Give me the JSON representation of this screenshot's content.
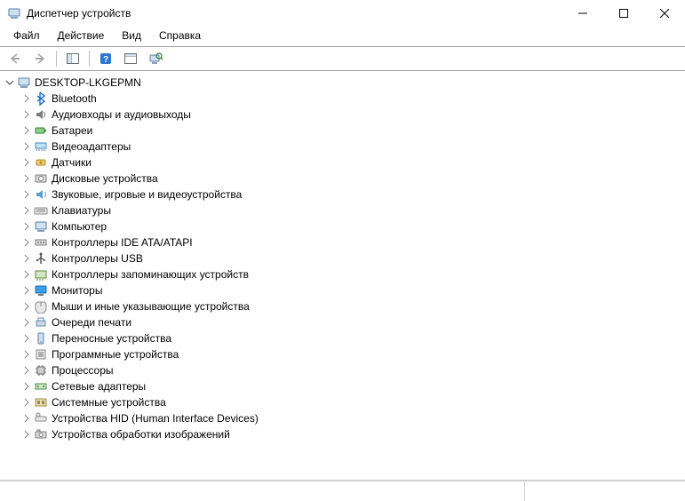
{
  "title": "Диспетчер устройств",
  "menu": {
    "file": "Файл",
    "action": "Действие",
    "view": "Вид",
    "help": "Справка"
  },
  "root": {
    "name": "DESKTOP-LKGEPMN"
  },
  "categories": [
    {
      "icon": "bluetooth",
      "label": "Bluetooth"
    },
    {
      "icon": "audio",
      "label": "Аудиовходы и аудиовыходы"
    },
    {
      "icon": "battery",
      "label": "Батареи"
    },
    {
      "icon": "display-adapter",
      "label": "Видеоадаптеры"
    },
    {
      "icon": "sensor",
      "label": "Датчики"
    },
    {
      "icon": "disk",
      "label": "Дисковые устройства"
    },
    {
      "icon": "sound-game",
      "label": "Звуковые, игровые и видеоустройства"
    },
    {
      "icon": "keyboard",
      "label": "Клавиатуры"
    },
    {
      "icon": "computer",
      "label": "Компьютер"
    },
    {
      "icon": "ide",
      "label": "Контроллеры IDE ATA/ATAPI"
    },
    {
      "icon": "usb",
      "label": "Контроллеры USB"
    },
    {
      "icon": "storage-ctrl",
      "label": "Контроллеры запоминающих устройств"
    },
    {
      "icon": "monitor",
      "label": "Мониторы"
    },
    {
      "icon": "mouse",
      "label": "Мыши и иные указывающие устройства"
    },
    {
      "icon": "print-queue",
      "label": "Очереди печати"
    },
    {
      "icon": "portable",
      "label": "Переносные устройства"
    },
    {
      "icon": "software-dev",
      "label": "Программные устройства"
    },
    {
      "icon": "cpu",
      "label": "Процессоры"
    },
    {
      "icon": "network",
      "label": "Сетевые адаптеры"
    },
    {
      "icon": "system-dev",
      "label": "Системные устройства"
    },
    {
      "icon": "hid",
      "label": "Устройства HID (Human Interface Devices)"
    },
    {
      "icon": "imaging",
      "label": "Устройства обработки изображений"
    }
  ]
}
